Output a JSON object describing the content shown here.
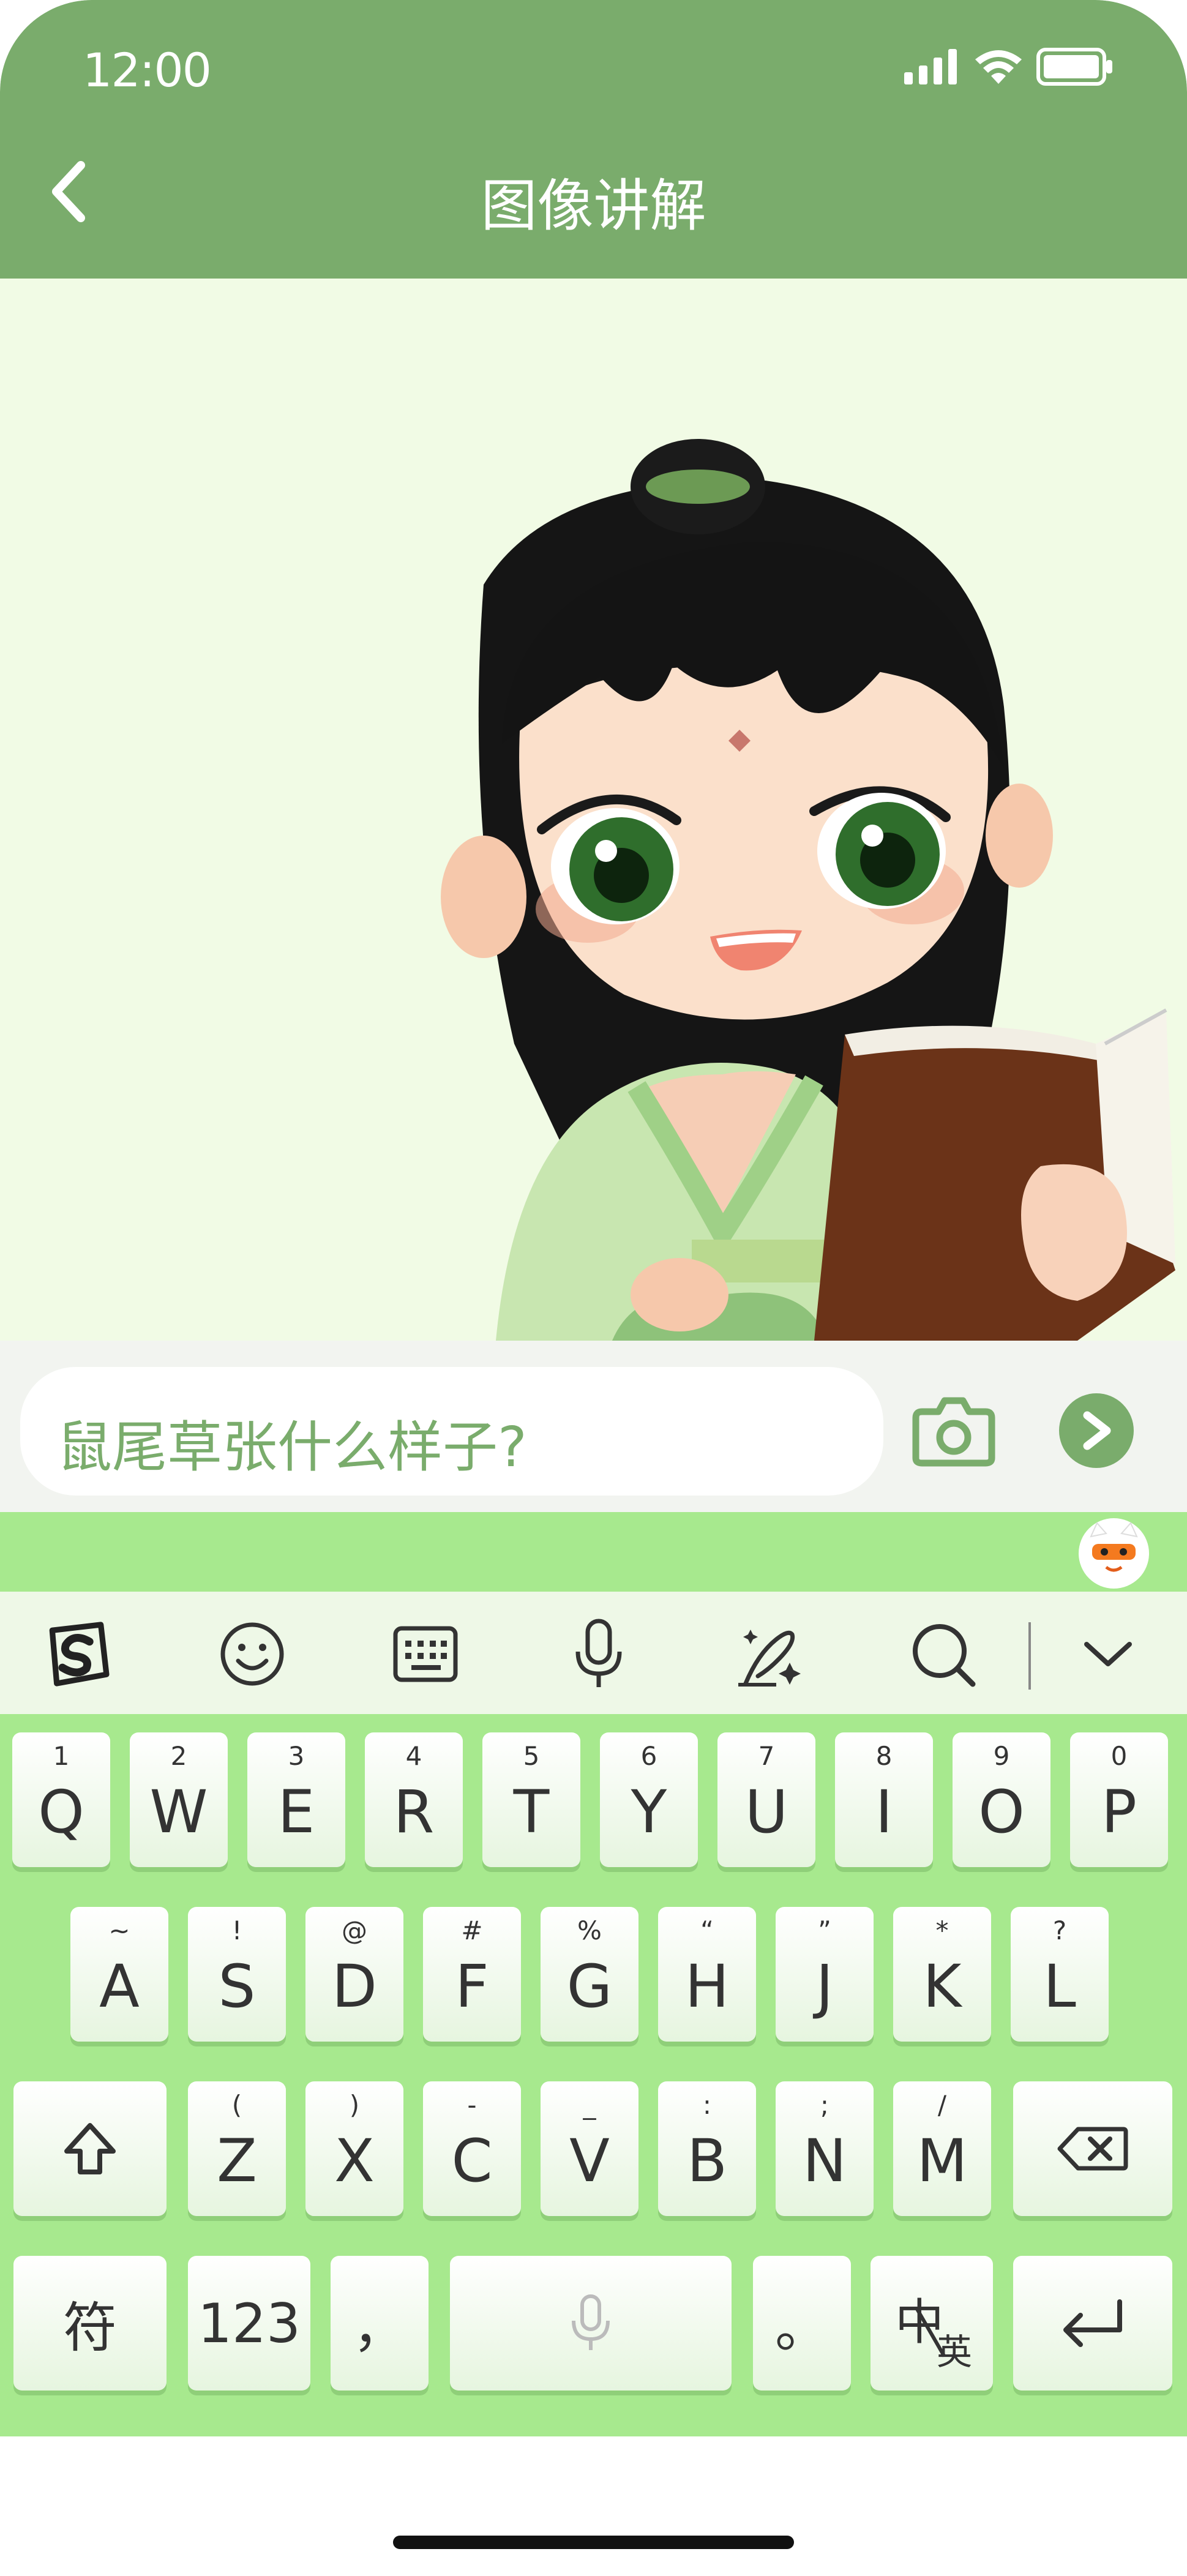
{
  "status": {
    "time": "12:00"
  },
  "header": {
    "title": "图像讲解"
  },
  "input": {
    "value": "鼠尾草张什么样子?"
  },
  "keyboard": {
    "row1": [
      {
        "main": "Q",
        "sub": "1"
      },
      {
        "main": "W",
        "sub": "2"
      },
      {
        "main": "E",
        "sub": "3"
      },
      {
        "main": "R",
        "sub": "4"
      },
      {
        "main": "T",
        "sub": "5"
      },
      {
        "main": "Y",
        "sub": "6"
      },
      {
        "main": "U",
        "sub": "7"
      },
      {
        "main": "I",
        "sub": "8"
      },
      {
        "main": "O",
        "sub": "9"
      },
      {
        "main": "P",
        "sub": "0"
      }
    ],
    "row2": [
      {
        "main": "A",
        "sub": "~"
      },
      {
        "main": "S",
        "sub": "!"
      },
      {
        "main": "D",
        "sub": "@"
      },
      {
        "main": "F",
        "sub": "#"
      },
      {
        "main": "G",
        "sub": "%"
      },
      {
        "main": "H",
        "sub": "“"
      },
      {
        "main": "J",
        "sub": "”"
      },
      {
        "main": "K",
        "sub": "*"
      },
      {
        "main": "L",
        "sub": "?"
      }
    ],
    "row3": [
      {
        "main": "Z",
        "sub": "("
      },
      {
        "main": "X",
        "sub": ")"
      },
      {
        "main": "C",
        "sub": "-"
      },
      {
        "main": "V",
        "sub": "_"
      },
      {
        "main": "B",
        "sub": ":"
      },
      {
        "main": "N",
        "sub": ";"
      },
      {
        "main": "M",
        "sub": "/"
      }
    ],
    "symbol_key": "符",
    "number_key": "123",
    "comma_key": "，",
    "period_key": "。",
    "lang_key_main": "中",
    "lang_key_sub": "英"
  },
  "colors": {
    "accent": "#7aac6c",
    "content_bg": "#f1fbe5",
    "keyboard_bg": "#a7e98e",
    "toolbar_bg": "#eef8e7"
  },
  "icons": {
    "back": "chevron-left-icon",
    "camera": "camera-icon",
    "send": "send-arrow-icon",
    "toolbar": [
      "sogou-logo-icon",
      "emoji-icon",
      "keyboard-icon",
      "microphone-icon",
      "handwriting-icon",
      "search-icon",
      "chevron-down-icon"
    ]
  }
}
